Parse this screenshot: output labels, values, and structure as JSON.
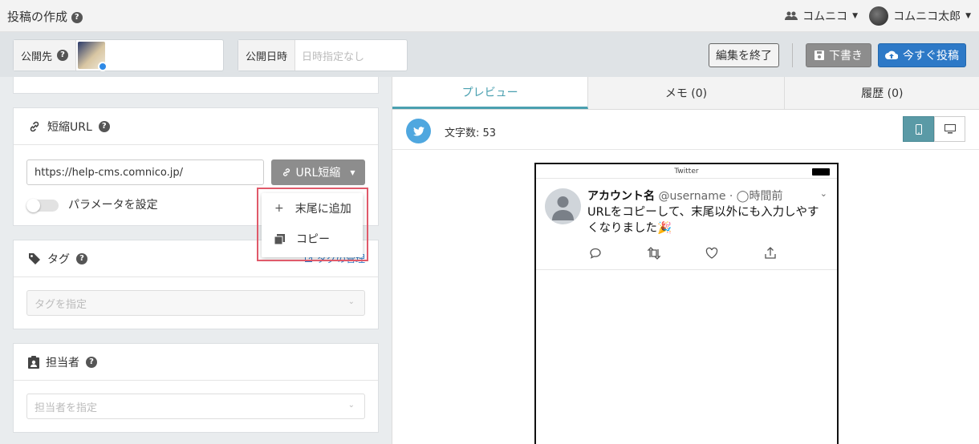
{
  "topbar": {
    "title": "投稿の作成",
    "help": "?",
    "team": "コムニコ",
    "user": "コムニコ太郎"
  },
  "publish": {
    "dest_label": "公開先",
    "date_label": "公開日時",
    "date_placeholder": "日時指定なし"
  },
  "actions": {
    "end_edit": "編集を終了",
    "draft": "下書き",
    "post_now": "今すぐ投稿"
  },
  "short_url": {
    "header": "短縮URL",
    "input_value": "https://help-cms.comnico.jp/",
    "button": "URL短縮",
    "param_toggle": "パラメータを設定",
    "menu": [
      {
        "icon": "plus-icon",
        "label": "末尾に追加"
      },
      {
        "icon": "copy-icon",
        "label": "コピー"
      }
    ]
  },
  "tags": {
    "header": "タグ",
    "manage_link": "タグの管理",
    "placeholder": "タグを指定"
  },
  "assignee": {
    "header": "担当者",
    "placeholder": "担当者を指定"
  },
  "tabs": {
    "preview": "プレビュー",
    "memo": "メモ (0)",
    "history": "履歴 (0)"
  },
  "preview": {
    "char_count_label": "文字数: 53",
    "status_bar": "Twitter",
    "account_name": "アカウント名",
    "handle": "@username · ◯時間前",
    "tweet_text": "URLをコピーして、末尾以外にも入力しやすくなりました🎉"
  },
  "colors": {
    "accent_teal": "#4aa0b0",
    "post_blue": "#2d79c7",
    "twitter_blue": "#4fa7df",
    "highlight_red": "#e05a6a"
  }
}
